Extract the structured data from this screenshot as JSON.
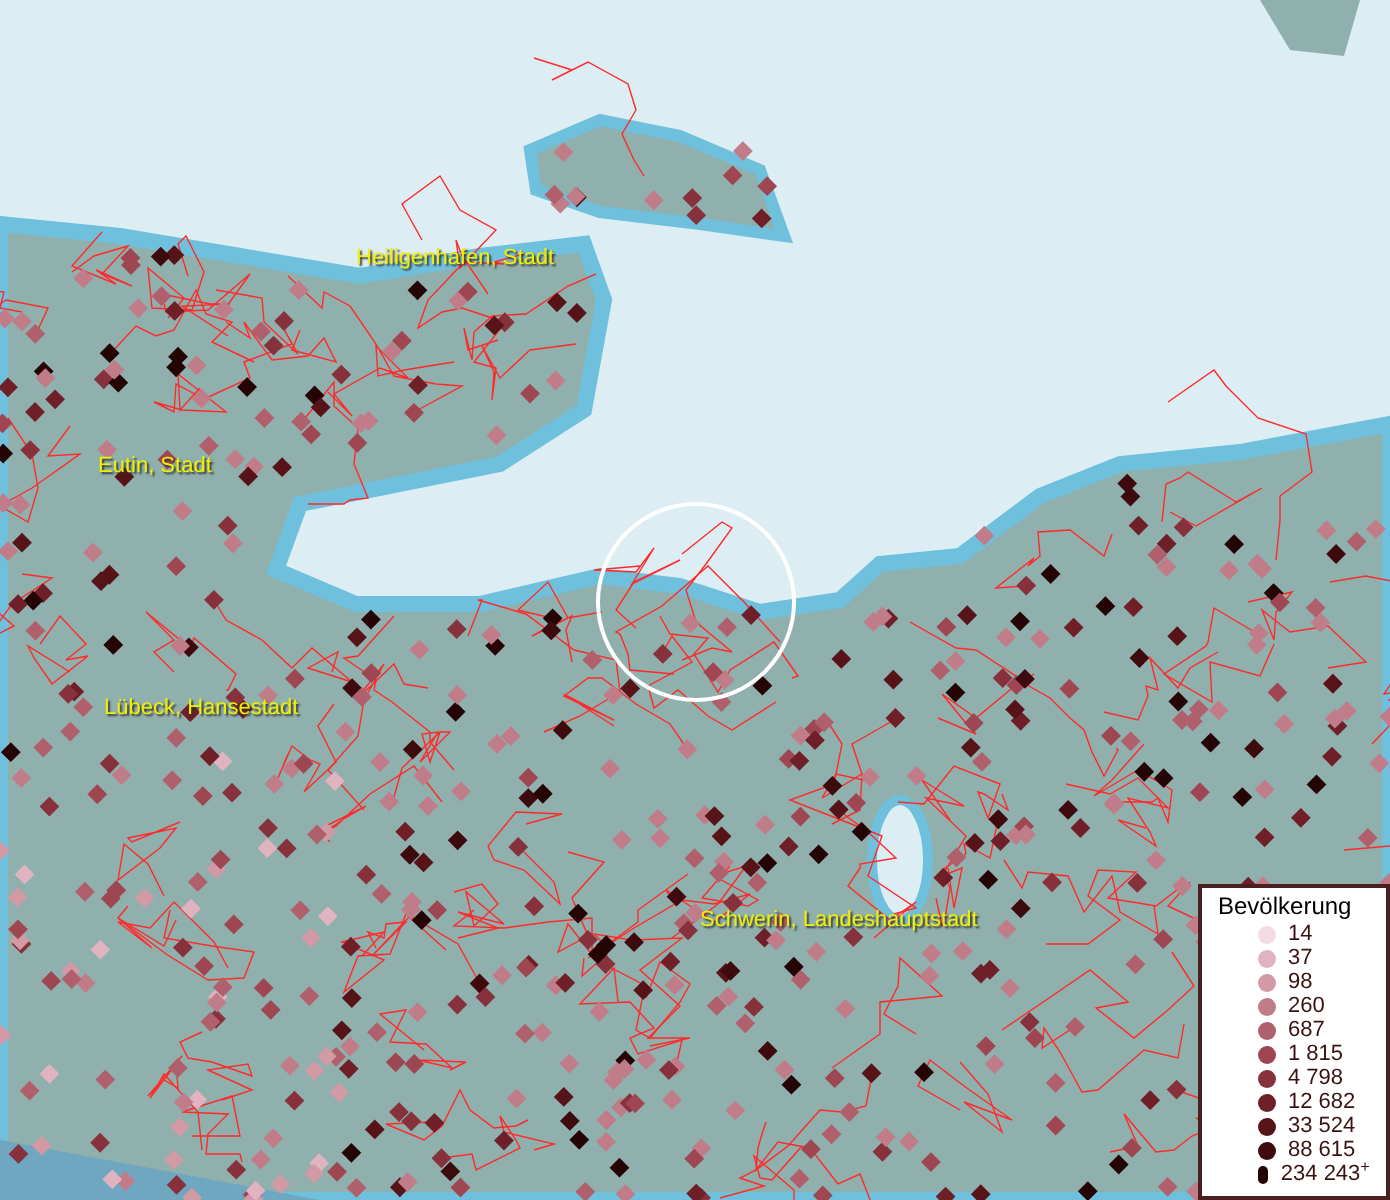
{
  "map": {
    "place_labels": [
      {
        "label": "Heiligenhafen, Stadt"
      },
      {
        "label": "Eutin, Stadt"
      },
      {
        "label": "Lübeck, Hansestadt"
      },
      {
        "label": "Schwerin, Landeshauptstadt"
      }
    ]
  },
  "legend": {
    "title": "Bevölkerung",
    "items": [
      {
        "label": "14",
        "color": "#f3dbe6"
      },
      {
        "label": "37",
        "color": "#e0b3c0"
      },
      {
        "label": "98",
        "color": "#d19aa5"
      },
      {
        "label": "260",
        "color": "#c07c88"
      },
      {
        "label": "687",
        "color": "#b0606c"
      },
      {
        "label": "1 815",
        "color": "#9e4752"
      },
      {
        "label": "4 798",
        "color": "#86313b"
      },
      {
        "label": "12 682",
        "color": "#6e1f27"
      },
      {
        "label": "33 524",
        "color": "#561419"
      },
      {
        "label": "88 615",
        "color": "#3d0a0e"
      },
      {
        "label": "234 243$^{+}$",
        "color": "#250406"
      }
    ]
  }
}
